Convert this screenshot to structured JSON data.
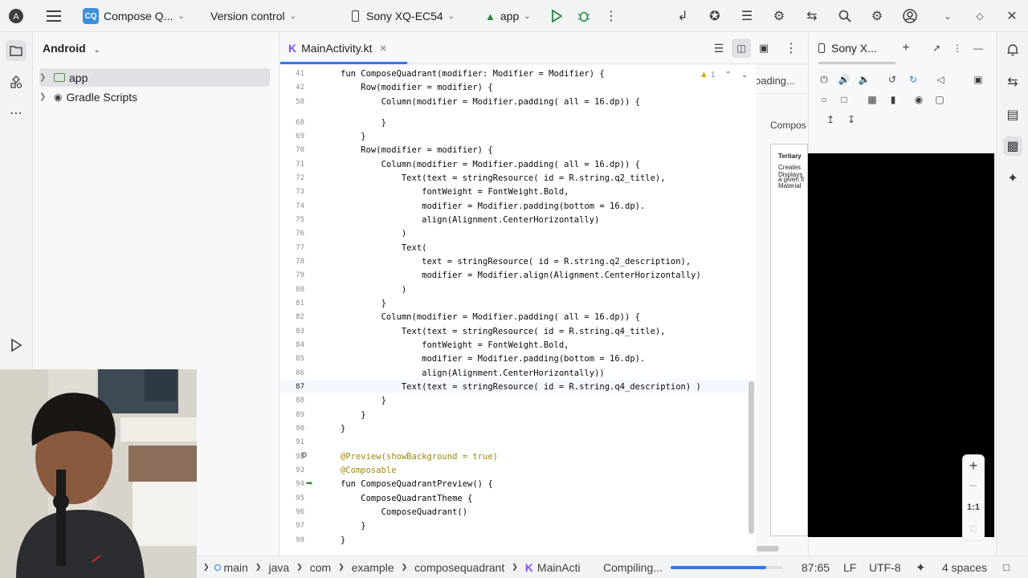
{
  "topbar": {
    "project_badge": "CQ",
    "project_name": "Compose Q...",
    "vcs": "Version control",
    "device": "Sony XQ-EC54",
    "run_config": "app"
  },
  "project_panel": {
    "title": "Android",
    "items": [
      {
        "label": "app"
      },
      {
        "label": "Gradle Scripts"
      }
    ]
  },
  "editor": {
    "tab_label": "MainActivity.kt",
    "warning_count": "1",
    "lines": [
      {
        "n": "41",
        "t": "fun ComposeQuadrant(modifier: Modifier = Modifier) {"
      },
      {
        "n": "42",
        "t": "    Row(modifier = modifier) {"
      },
      {
        "n": "58",
        "t": "        Column(modifier = Modifier.padding( all = 16.dp)) {"
      },
      {
        "n": "68",
        "t": "        }"
      },
      {
        "n": "69",
        "t": "    }"
      },
      {
        "n": "70",
        "t": "    Row(modifier = modifier) {"
      },
      {
        "n": "71",
        "t": "        Column(modifier = Modifier.padding( all = 16.dp)) {"
      },
      {
        "n": "72",
        "t": "            Text(text = stringResource( id = R.string.q2_title),"
      },
      {
        "n": "73",
        "t": "                fontWeight = FontWeight.Bold,"
      },
      {
        "n": "74",
        "t": "                modifier = Modifier.padding(bottom = 16.dp)."
      },
      {
        "n": "75",
        "t": "                align(Alignment.CenterHorizontally)"
      },
      {
        "n": "76",
        "t": "            )"
      },
      {
        "n": "77",
        "t": "            Text("
      },
      {
        "n": "78",
        "t": "                text = stringResource( id = R.string.q2_description),"
      },
      {
        "n": "79",
        "t": "                modifier = Modifier.align(Alignment.CenterHorizontally)"
      },
      {
        "n": "80",
        "t": "            )"
      },
      {
        "n": "81",
        "t": "        }"
      },
      {
        "n": "82",
        "t": "        Column(modifier = Modifier.padding( all = 16.dp)) {"
      },
      {
        "n": "83",
        "t": "            Text(text = stringResource( id = R.string.q4_title),"
      },
      {
        "n": "84",
        "t": "                fontWeight = FontWeight.Bold,"
      },
      {
        "n": "85",
        "t": "                modifier = Modifier.padding(bottom = 16.dp)."
      },
      {
        "n": "86",
        "t": "                align(Alignment.CenterHorizontally))"
      },
      {
        "n": "87",
        "t": "            Text(text = stringResource( id = R.string.q4_description) )"
      },
      {
        "n": "88",
        "t": "        }"
      },
      {
        "n": "89",
        "t": "    }"
      },
      {
        "n": "90",
        "t": "}"
      },
      {
        "n": "91",
        "t": ""
      },
      {
        "n": "92",
        "t": "@Preview(showBackground = true)"
      },
      {
        "n": "93",
        "t": "@Composable"
      },
      {
        "n": "94",
        "t": "fun ComposeQuadrantPreview() {"
      },
      {
        "n": "95",
        "t": "    ComposeQuadrantTheme {"
      },
      {
        "n": "96",
        "t": "        ComposeQuadrant()"
      },
      {
        "n": "97",
        "t": "    }"
      },
      {
        "n": "98",
        "t": "}"
      }
    ]
  },
  "preview": {
    "loading_text": "oading...",
    "compose_label": "Compos",
    "mini_lines": [
      "Tertiary",
      "Creates",
      "Displays",
      "a given fi",
      "Material"
    ]
  },
  "device_panel": {
    "tab_label": "Sony X...",
    "zoom_label": "1:1"
  },
  "statusbar": {
    "crumbs": [
      "main",
      "java",
      "com",
      "example",
      "composequadrant",
      "MainActi"
    ],
    "task": "Compiling...",
    "task_progress": 0.85,
    "position": "87:65",
    "line_sep": "LF",
    "encoding": "UTF-8",
    "indent": "4 spaces"
  },
  "colors": {
    "accent": "#3574f0",
    "run_green": "#208a3c"
  }
}
